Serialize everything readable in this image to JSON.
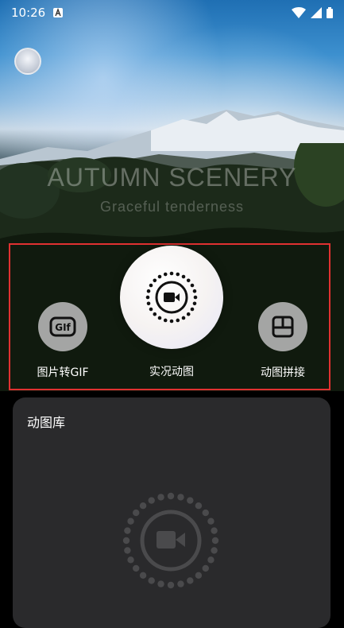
{
  "status_bar": {
    "time": "10:26",
    "notification_icon": "a-icon",
    "wifi_icon": "wifi-icon",
    "signal_icon": "signal-icon",
    "battery_icon": "battery-icon"
  },
  "hero": {
    "title": "AUTUMN SCENERY",
    "subtitle": "Graceful tenderness"
  },
  "actions": [
    {
      "label": "图片转GIF",
      "icon": "gif-icon"
    },
    {
      "label": "实况动图",
      "icon": "live-photo-icon"
    },
    {
      "label": "动图拼接",
      "icon": "grid-icon"
    }
  ],
  "library": {
    "title": "动图库",
    "icon": "live-photo-icon"
  }
}
